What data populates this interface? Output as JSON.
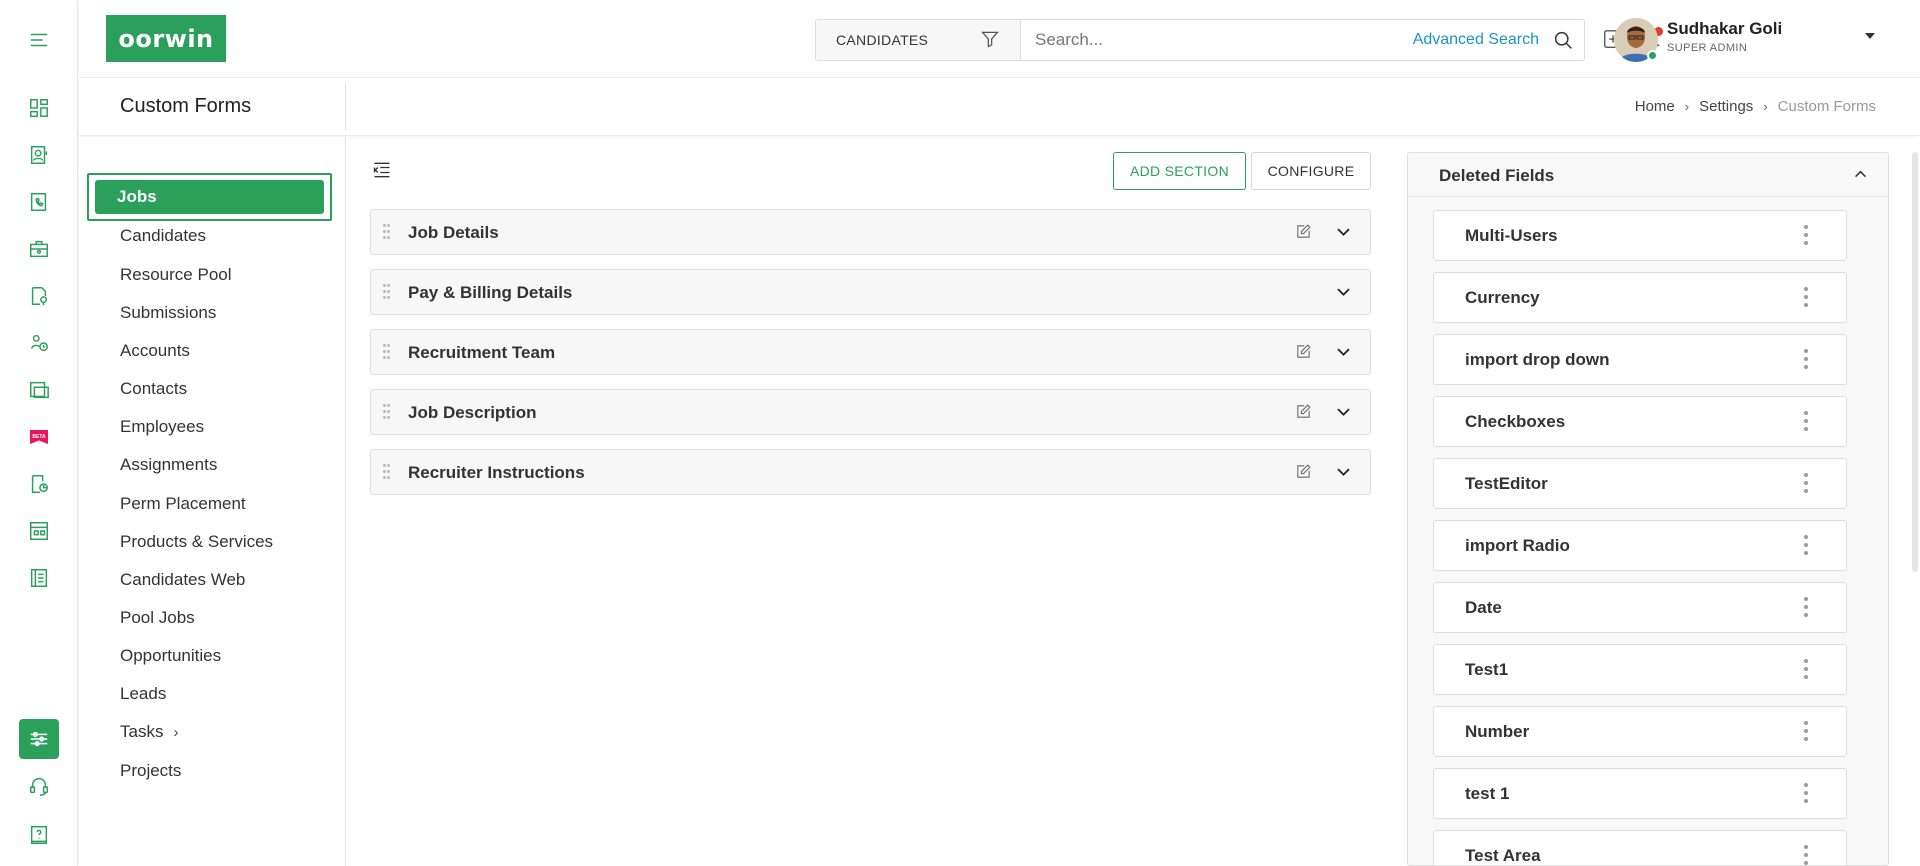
{
  "app": {
    "logo_text": "oorwin",
    "brand_color": "#2aa05a",
    "accent_link_color": "#1c93c6"
  },
  "rail": {
    "items": [
      {
        "icon": "hamburger-menu-icon"
      },
      {
        "icon": "dashboard-icon"
      },
      {
        "icon": "candidate-icon"
      },
      {
        "icon": "phone-icon"
      },
      {
        "icon": "briefcase-icon"
      },
      {
        "icon": "location-doc-icon"
      },
      {
        "icon": "clock-people-icon"
      },
      {
        "icon": "monitor-icon"
      },
      {
        "icon": "beta-ribbon-icon"
      },
      {
        "icon": "doc-refresh-icon"
      },
      {
        "icon": "grid-window-icon"
      },
      {
        "icon": "ledger-icon"
      },
      {
        "icon": "settings-sliders-icon",
        "active": true
      },
      {
        "icon": "headset-icon"
      },
      {
        "icon": "help-book-icon"
      }
    ]
  },
  "header": {
    "search_type": "CANDIDATES",
    "search_placeholder": "Search...",
    "advanced_search": "Advanced Search",
    "user": {
      "name": "Sudhakar Goli",
      "role": "SUPER ADMIN",
      "status_color": "#2aa05a"
    },
    "notification_dot_color": "#e83b2e"
  },
  "page": {
    "title": "Custom Forms",
    "breadcrumb": [
      "Home",
      "Settings",
      "Custom Forms"
    ]
  },
  "menu": {
    "active": "Jobs",
    "items": [
      "Candidates",
      "Resource Pool",
      "Submissions",
      "Accounts",
      "Contacts",
      "Employees",
      "Assignments",
      "Perm Placement",
      "Products & Services",
      "Candidates Web",
      "Pool Jobs",
      "Opportunities",
      "Leads",
      "Tasks",
      "Projects"
    ]
  },
  "toolbar": {
    "add_section": "ADD SECTION",
    "configure": "CONFIGURE"
  },
  "sections": [
    {
      "title": "Job Details",
      "editable": true
    },
    {
      "title": "Pay & Billing Details",
      "editable": false
    },
    {
      "title": "Recruitment Team",
      "editable": true
    },
    {
      "title": "Job Description",
      "editable": true
    },
    {
      "title": "Recruiter Instructions",
      "editable": true
    }
  ],
  "deleted_fields": {
    "title": "Deleted Fields",
    "items": [
      "Multi-Users",
      "Currency",
      "import drop down",
      "Checkboxes",
      "TestEditor",
      "import Radio",
      "Date",
      "Test1",
      "Number",
      "test 1",
      "Test Area"
    ]
  }
}
